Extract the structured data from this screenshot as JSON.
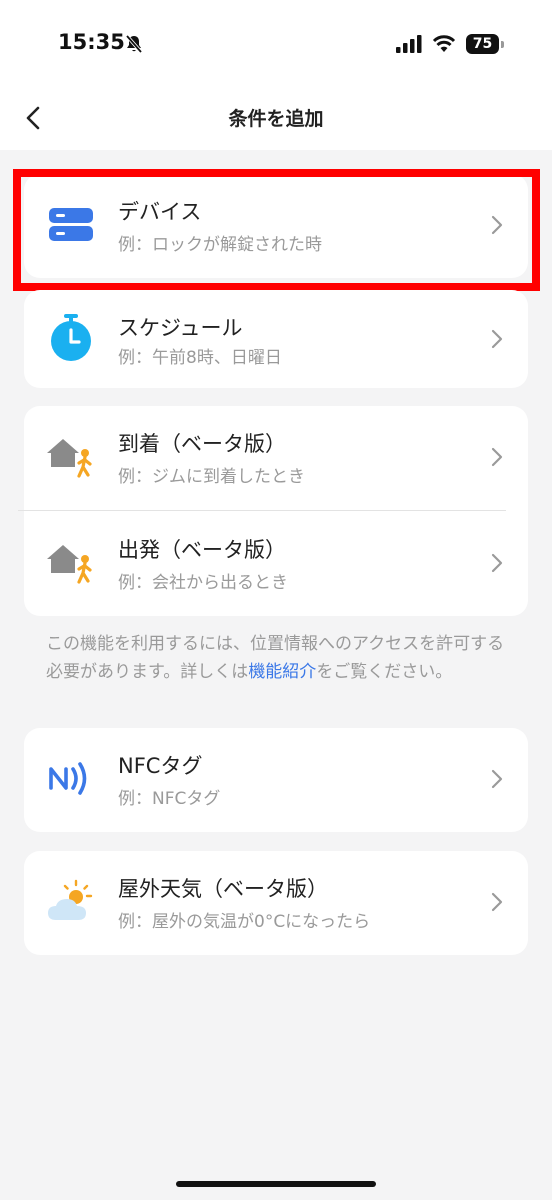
{
  "status_bar": {
    "time": "15:35",
    "battery": "75"
  },
  "header": {
    "title": "条件を追加"
  },
  "items": [
    {
      "name": "デバイス",
      "example": "例：ロックが解錠された時",
      "icon": "device-icon"
    },
    {
      "name": "スケジュール",
      "example": "例：午前8時、日曜日",
      "icon": "timer-icon"
    },
    {
      "name": "到着（ベータ版）",
      "example": "例：ジムに到着したとき",
      "icon": "arrive-home-icon"
    },
    {
      "name": "出発（ベータ版）",
      "example": "例：会社から出るとき",
      "icon": "leave-home-icon"
    },
    {
      "name": "NFCタグ",
      "example": "例：NFCタグ",
      "icon": "nfc-icon"
    },
    {
      "name": "屋外天気（ベータ版）",
      "example": "例：屋外の気温が0°Cになったら",
      "icon": "weather-icon"
    }
  ],
  "location_note": {
    "text_before": "この機能を利用するには、位置情報へのアクセスを許可する必要があります。詳しくは",
    "link": "機能紹介",
    "text_after": "をご覧ください。"
  },
  "colors": {
    "accent": "#3b78e7",
    "highlight": "#ff0000",
    "timer": "#1ab0f0",
    "person": "#f5a623"
  }
}
